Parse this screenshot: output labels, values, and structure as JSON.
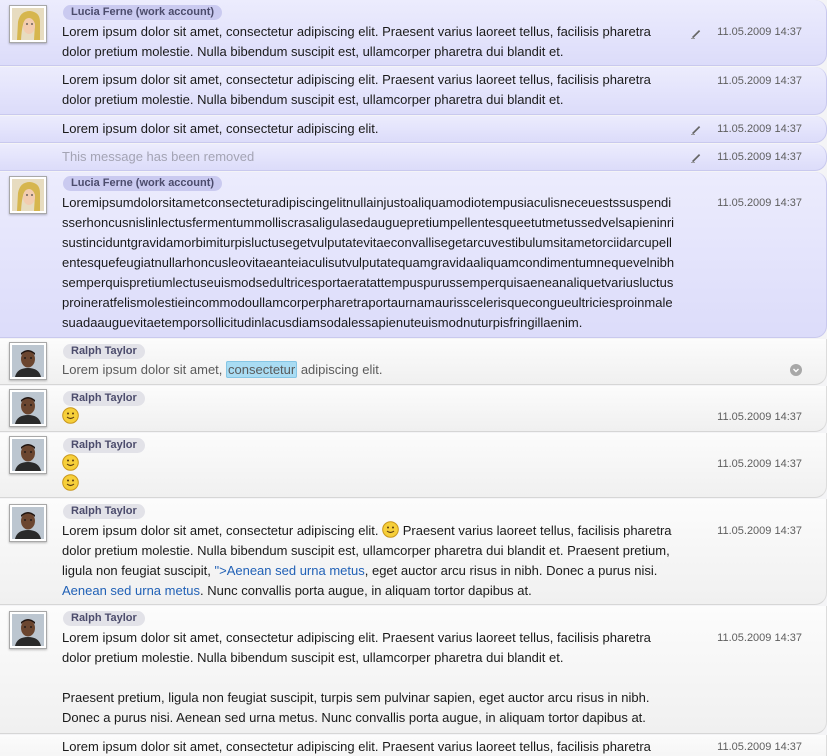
{
  "messages": [
    {
      "sender": "Lucia Ferne (work account)",
      "time": "11.05.2009 14:37",
      "text": "Lorem ipsum dolor sit amet, consectetur adipiscing elit. Praesent varius laoreet tellus, facilisis pharetra dolor pretium molestie. Nulla bibendum suscipit est, ullamcorper pharetra dui blandit et."
    },
    {
      "time": "11.05.2009 14:37",
      "text": "Lorem ipsum dolor sit amet, consectetur adipiscing elit. Praesent varius laoreet tellus, facilisis pharetra dolor pretium molestie. Nulla bibendum suscipit est, ullamcorper pharetra dui blandit et."
    },
    {
      "time": "11.05.2009 14:37",
      "text": "Lorem ipsum dolor sit amet, consectetur adipiscing elit."
    },
    {
      "time": "11.05.2009 14:37",
      "text": "This message has been removed"
    },
    {
      "sender": "Lucia Ferne (work account)",
      "time": "11.05.2009 14:37",
      "text": "Loremipsumdolorsitametconsecteturadipiscingelitnullainjustoaliquamodiotempusiaculisneceuestssuspendisserhoncusnislinlectusfermentummolliscrasaligulasedauguepretiumpellentesqueetutmetussedvelsapieninrisustinciduntgravidamorbimiturpisluctusegetvulputatevitaeconvallisegetarcuvestibulumsitametorciidarcupellentesquefeugiatnullarhoncusleovitaeanteiaculisutvulputatequamgravidaaliquamcondimentumnequevelnibhsemperquispretiumlectuseuismodsedultricesportaeratattempuspurussemperquisaeneanaliquetvariusluctusproineratfelismolestieincommodoullamcorperpharetraportaurnamaurisscelerisquecongueultriciesproinmalesuadaauguevitaetemporsollicitudinlacusdiamsodalessapienuteuismodnuturpisfringillaenim."
    },
    {
      "sender": "Ralph Taylor",
      "text_before": "Lorem ipsum dolor sit amet, ",
      "highlight": "consectetur",
      "text_after": " adipiscing elit."
    },
    {
      "sender": "Ralph Taylor",
      "time": "11.05.2009 14:37"
    },
    {
      "sender": "Ralph Taylor",
      "time": "11.05.2009 14:37"
    },
    {
      "sender": "Ralph Taylor",
      "time": "11.05.2009 14:37",
      "p1": "Lorem ipsum dolor sit amet, consectetur adipiscing elit.",
      "p2": " Praesent varius laoreet tellus, facilisis pharetra dolor pretium molestie. Nulla bibendum suscipit est, ullamcorper pharetra dui blandit et. Praesent pretium, ligula non feugiat suscipit, ",
      "link1": "\">Aenean sed urna metus",
      "p3": ", eget auctor arcu risus in nibh. Donec a purus nisi. ",
      "link2": "Aenean sed urna metus",
      "p4": ". Nunc convallis porta augue, in aliquam tortor dapibus at."
    },
    {
      "sender": "Ralph Taylor",
      "time": "11.05.2009 14:37",
      "para1": "Lorem ipsum dolor sit amet, consectetur adipiscing elit. Praesent varius laoreet tellus, facilisis pharetra dolor pretium molestie. Nulla bibendum suscipit est, ullamcorper pharetra dui blandit et.",
      "para2": "Praesent pretium, ligula non feugiat suscipit, turpis sem pulvinar sapien, eget auctor arcu risus in nibh. Donec a purus nisi. Aenean sed urna metus. Nunc convallis porta augue, in aliquam tortor dapibus at."
    },
    {
      "time": "11.05.2009 14:37",
      "text": "Lorem ipsum dolor sit amet, consectetur adipiscing elit. Praesent varius laoreet tellus, facilisis pharetra"
    }
  ]
}
